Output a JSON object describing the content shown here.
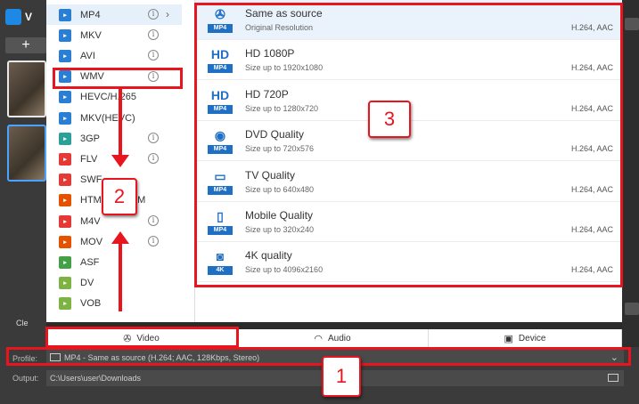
{
  "app": {
    "logo_text": "V",
    "add_label": "+",
    "strip_bottom": "Cle"
  },
  "formats": [
    {
      "label": "MP4",
      "icon": "video-file-icon",
      "color": "#2a7fd4",
      "info": true,
      "chevron": true,
      "selected": true
    },
    {
      "label": "MKV",
      "icon": "mkv-icon",
      "color": "#2a7fd4",
      "info": true
    },
    {
      "label": "AVI",
      "icon": "avi-icon",
      "color": "#2a7fd4",
      "info": true
    },
    {
      "label": "WMV",
      "icon": "wmv-icon",
      "color": "#2a7fd4",
      "info": true
    },
    {
      "label": "HEVC/H.265",
      "icon": "hevc-icon",
      "color": "#2a7fd4",
      "info": false
    },
    {
      "label": "MKV(HEVC)",
      "icon": "mkv-hevc-icon",
      "color": "#2a7fd4",
      "info": false
    },
    {
      "label": "3GP",
      "icon": "3gp-icon",
      "color": "#2aa198",
      "info": true
    },
    {
      "label": "FLV",
      "icon": "flv-icon",
      "color": "#e53935",
      "info": true
    },
    {
      "label": "SWF",
      "icon": "swf-icon",
      "color": "#e53935",
      "info": false
    },
    {
      "label": "HTML5 WEBM",
      "icon": "html5-icon",
      "color": "#e65100",
      "info": false
    },
    {
      "label": "M4V",
      "icon": "m4v-icon",
      "color": "#e53935",
      "info": true
    },
    {
      "label": "MOV",
      "icon": "mov-icon",
      "color": "#e65100",
      "info": true
    },
    {
      "label": "ASF",
      "icon": "asf-icon",
      "color": "#43a047",
      "info": false
    },
    {
      "label": "DV",
      "icon": "dv-icon",
      "color": "#7cb342",
      "info": false
    },
    {
      "label": "VOB",
      "icon": "vob-icon",
      "color": "#7cb342",
      "info": false
    }
  ],
  "qualities": [
    {
      "title": "Same as source",
      "sub": "Original Resolution",
      "codec": "H.264, AAC",
      "glyph": "✇",
      "tag": "MP4",
      "icon": "film-reel-icon",
      "selected": true
    },
    {
      "title": "HD 1080P",
      "sub": "Size up to 1920x1080",
      "codec": "H.264, AAC",
      "glyph": "HD",
      "tag": "MP4",
      "icon": "hd-1080-icon"
    },
    {
      "title": "HD 720P",
      "sub": "Size up to 1280x720",
      "codec": "H.264, AAC",
      "glyph": "HD",
      "tag": "MP4",
      "icon": "hd-720-icon"
    },
    {
      "title": "DVD Quality",
      "sub": "Size up to 720x576",
      "codec": "H.264, AAC",
      "glyph": "◉",
      "tag": "MP4",
      "icon": "dvd-icon"
    },
    {
      "title": "TV Quality",
      "sub": "Size up to 640x480",
      "codec": "H.264, AAC",
      "glyph": "▭",
      "tag": "MP4",
      "icon": "tv-icon"
    },
    {
      "title": "Mobile Quality",
      "sub": "Size up to 320x240",
      "codec": "H.264, AAC",
      "glyph": "▯",
      "tag": "MP4",
      "icon": "mobile-icon"
    },
    {
      "title": "4K quality",
      "sub": "Size up to 4096x2160",
      "codec": "H.264, AAC",
      "glyph": "◙",
      "tag": "4K",
      "icon": "4k-camera-icon"
    }
  ],
  "tabs": [
    {
      "label": "Video",
      "icon": "video-reel-icon",
      "glyph": "✇",
      "active": true
    },
    {
      "label": "Audio",
      "icon": "headphones-icon",
      "glyph": "🎧",
      "active": false
    },
    {
      "label": "Device",
      "icon": "device-icon",
      "glyph": "▣",
      "active": false
    }
  ],
  "profile": {
    "label": "Profile:",
    "value": "MP4 - Same as source (H.264; AAC, 128Kbps, Stereo)"
  },
  "output": {
    "label": "Output:",
    "value": "C:\\Users\\user\\Downloads"
  },
  "annotations": {
    "badge1": "1",
    "badge2": "2",
    "badge3": "3"
  },
  "colors": {
    "annotation_red": "#e8141e",
    "accent_blue": "#2196f3"
  }
}
